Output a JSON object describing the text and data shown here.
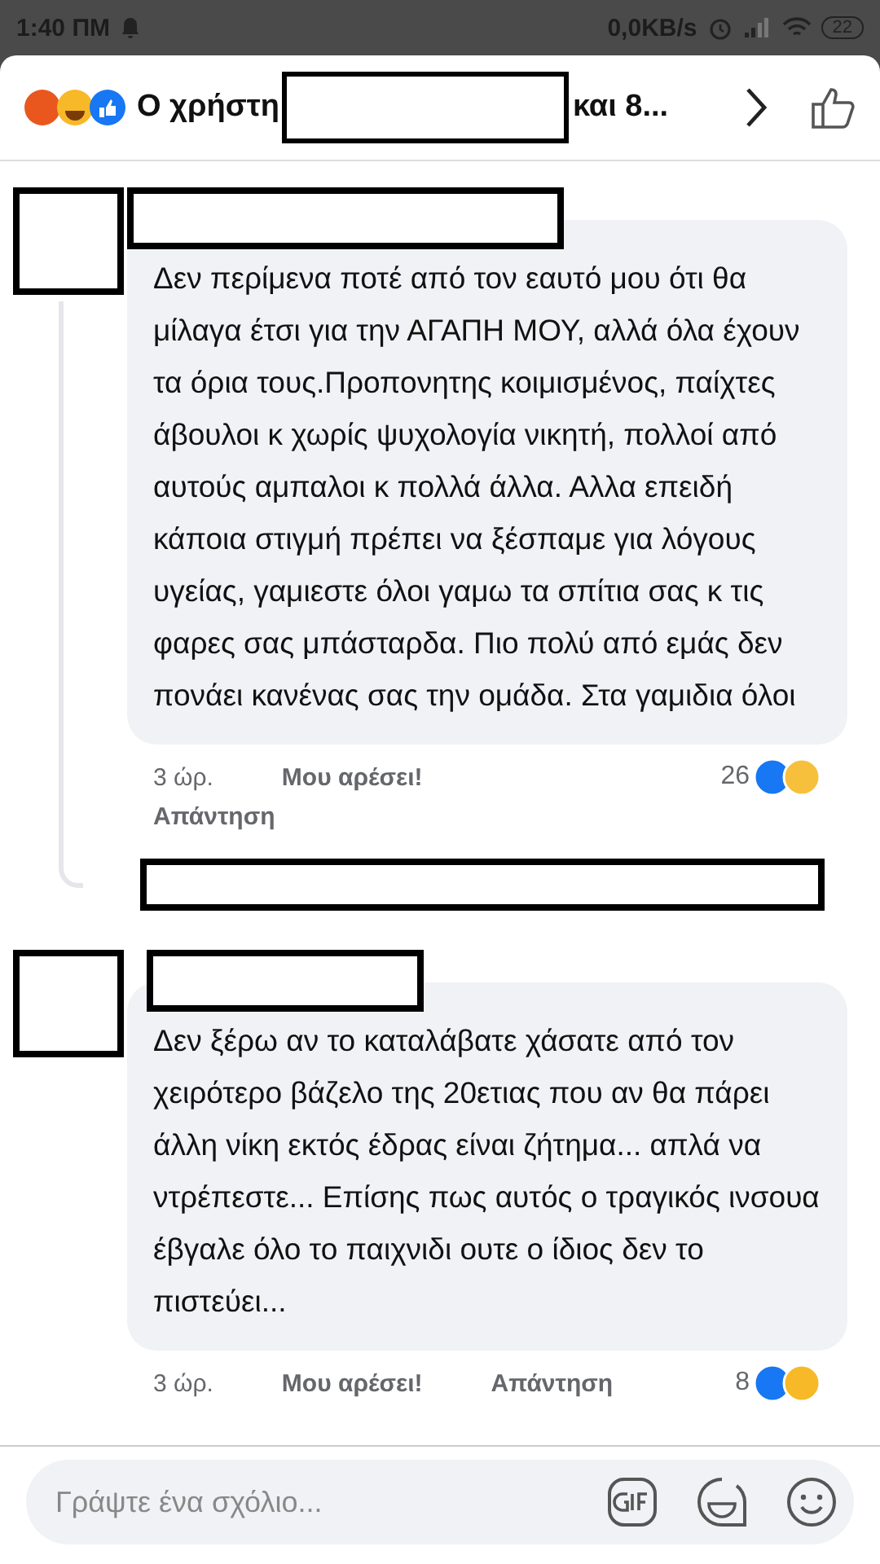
{
  "status_bar": {
    "time": "1:40 ΠΜ",
    "speed": "0,0KB/s",
    "battery": "22"
  },
  "header": {
    "title_start": "Ο χρήστη",
    "title_end": "και 8..."
  },
  "comments": [
    {
      "text": "Δεν περίμενα ποτέ από τον εαυτό μου ότι θα μίλαγα έτσι για την ΑΓΑΠΗ ΜΟΥ, αλλά όλα έχουν τα όρια τους.Προπονητης κοιμισμένος, παίχτες άβουλοι κ χωρίς ψυχολογία νικητή, πολλοί από αυτούς αμπαλοι κ πολλά άλλα. Αλλα επειδή κάποια στιγμή πρέπει να ξέσπαμε για λόγους υγείας, γαμιεστε όλοι γαμω τα σπίτια σας κ τις φαρες σας μπάσταρδα. Πιο πολύ από εμάς δεν πονάει κανένας σας την ομάδα. Στα γαμιδια όλοι",
      "time": "3 ώρ.",
      "like": "Μου αρέσει!",
      "reply": "Απάντηση",
      "count": "26",
      "reactions": [
        {
          "kind": "like"
        },
        {
          "kind": "care"
        }
      ],
      "has_replies": true
    },
    {
      "text": "Δεν ξέρω αν το καταλάβατε χάσατε από τον χειρότερο βάζελο της 20ετιας που αν θα πάρει άλλη νίκη εκτός έδρας είναι ζήτημα... απλά να ντρέπεστε... Επίσης πως αυτός ο τραγικός ινσουα έβγαλε όλο το παιχνιδι ουτε ο ίδιος δεν το πιστεύει...",
      "time": "3 ώρ.",
      "like": "Μου αρέσει!",
      "reply": "Απάντηση",
      "count": "8",
      "reactions": [
        {
          "kind": "like"
        },
        {
          "kind": "haha"
        }
      ],
      "has_replies": false
    }
  ],
  "composer": {
    "placeholder": "Γράψτε ένα σχόλιο..."
  }
}
